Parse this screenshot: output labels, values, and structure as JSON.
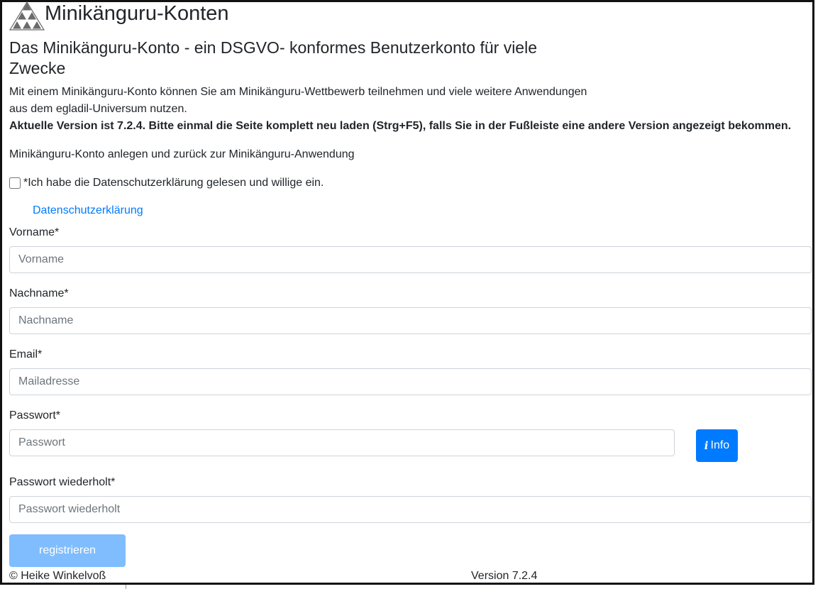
{
  "app": {
    "title": "Minikänguru-Konten",
    "logo": "triangle-logo-icon"
  },
  "intro": {
    "heading": "Das Minikänguru-Konto - ein DSGVO- konformes Benutzerkonto für viele Zwecke",
    "text": "Mit einem Minikänguru-Konto können Sie am Minikänguru-Wettbewerb teilnehmen und viele weitere Anwendungen aus dem egladil-Universum nutzen.",
    "version_note": "Aktuelle Version ist 7.2.4. Bitte einmal die Seite komplett neu laden (Strg+F5), falls Sie in der Fußleiste eine andere Version angezeigt bekommen.",
    "subline": "Minikänguru-Konto anlegen und zurück zur Minikänguru-Anwendung"
  },
  "consent": {
    "label": "*Ich habe die Datenschutzerklärung gelesen und willige ein.",
    "checked": false,
    "link_text": "Datenschutzerklärung"
  },
  "form": {
    "firstname": {
      "label": "Vorname*",
      "placeholder": "Vorname",
      "value": ""
    },
    "lastname": {
      "label": "Nachname*",
      "placeholder": "Nachname",
      "value": ""
    },
    "email": {
      "label": "Email*",
      "placeholder": "Mailadresse",
      "value": ""
    },
    "password": {
      "label": "Passwort*",
      "placeholder": "Passwort",
      "value": ""
    },
    "password_repeat": {
      "label": "Passwort wiederholt*",
      "placeholder": "Passwort wiederholt",
      "value": ""
    },
    "info_button": {
      "icon": "info-icon",
      "label": "Info"
    },
    "submit_label": "registrieren"
  },
  "footer": {
    "copyright": "© Heike Winkelvoß",
    "version": "Version 7.2.4"
  },
  "colors": {
    "primary": "#007bff",
    "primary_disabled": "#7fbdff",
    "link": "#007bff",
    "text": "#212529",
    "logo": "#666666"
  }
}
